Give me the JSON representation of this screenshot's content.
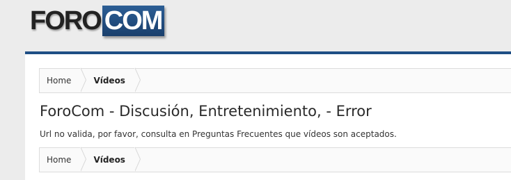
{
  "logo": {
    "part1": "FORO",
    "part2": "COM"
  },
  "breadcrumb_top": {
    "items": [
      {
        "label": "Home"
      },
      {
        "label": "Vídeos"
      }
    ]
  },
  "page": {
    "title": "ForoCom - Discusión, Entretenimiento, - Error",
    "message": "Url no valida, por favor, consulta en Preguntas Frecuentes que vídeos son aceptados."
  },
  "breadcrumb_bottom": {
    "items": [
      {
        "label": "Home"
      },
      {
        "label": "Vídeos"
      }
    ]
  },
  "colors": {
    "accent_bar": "#1f4f85",
    "logo_com_bg": "#2c5e95",
    "page_bg": "#ececec"
  }
}
